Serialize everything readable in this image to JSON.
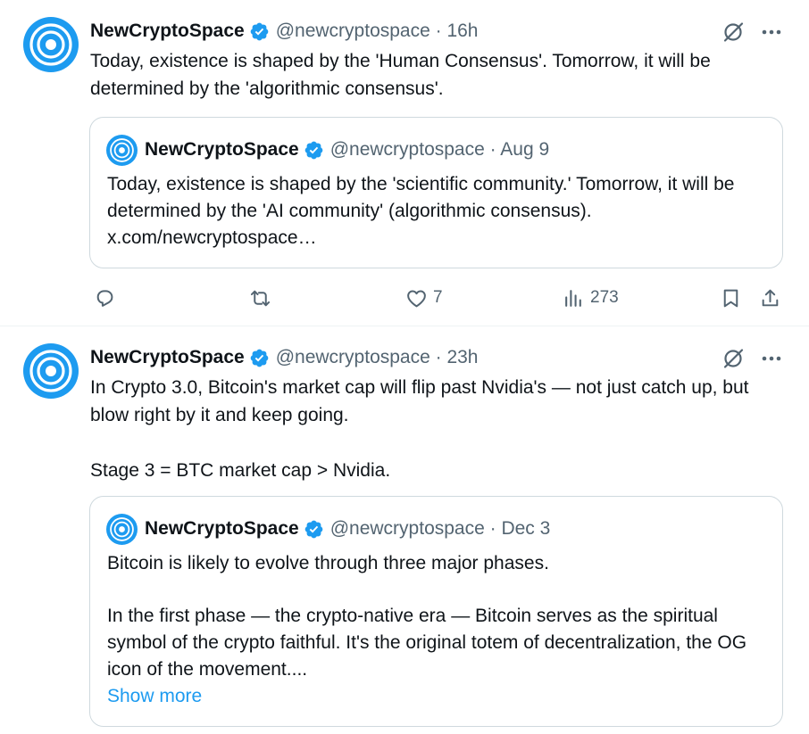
{
  "colors": {
    "accent": "#1d9bf0",
    "text": "#0f1419",
    "secondary": "#536471",
    "border": "#cfd9de"
  },
  "tweets": [
    {
      "author": {
        "name": "NewCryptoSpace",
        "handle_line": "@newcryptospace · 16h"
      },
      "text": [
        "Today, existence is shaped by the 'Human Consensus'. Tomorrow, it will be determined by the 'algorithmic consensus'."
      ],
      "quote": {
        "author": {
          "name": "NewCryptoSpace",
          "handle_line": "@newcryptospace · Aug 9"
        },
        "text": [
          "Today, existence is shaped by the 'scientific community.' Tomorrow, it will be determined by the 'AI community' (algorithmic consensus). x.com/newcryptospace…"
        ]
      },
      "actions": {
        "likes": "7",
        "views": "273"
      }
    },
    {
      "author": {
        "name": "NewCryptoSpace",
        "handle_line": "@newcryptospace · 23h"
      },
      "text": [
        "In Crypto 3.0, Bitcoin's market cap will flip past Nvidia's — not just catch up, but blow right by it and keep going.",
        "Stage 3 = BTC market cap > Nvidia."
      ],
      "quote": {
        "author": {
          "name": "NewCryptoSpace",
          "handle_line": "@newcryptospace · Dec 3"
        },
        "text": [
          "Bitcoin is likely to evolve through three major phases.",
          "In the first phase — the crypto-native era — Bitcoin serves as the spiritual symbol of the crypto faithful. It's the original totem of decentralization, the OG icon of the movement...."
        ],
        "show_more": "Show more"
      }
    }
  ]
}
